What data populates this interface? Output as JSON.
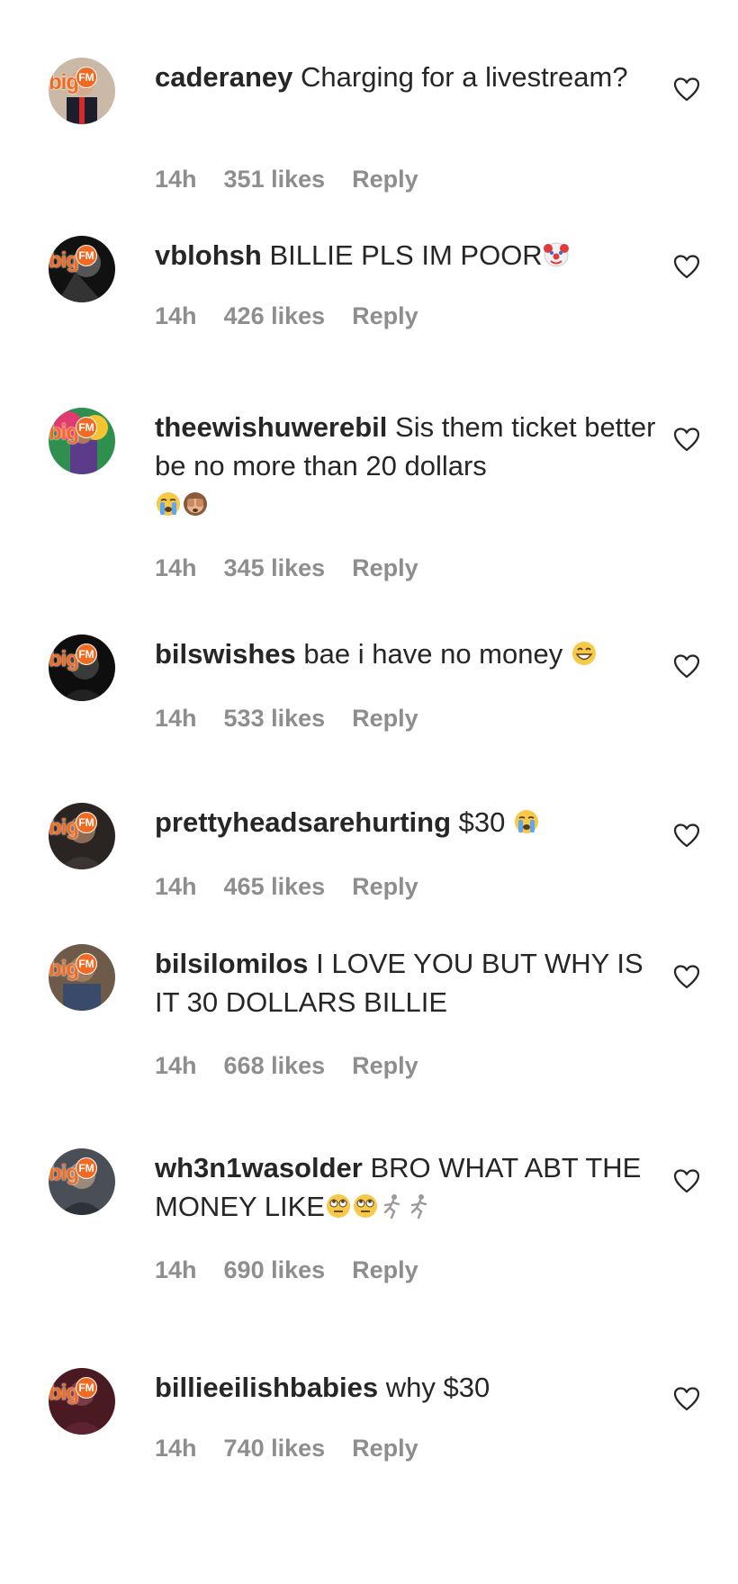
{
  "comments": [
    {
      "user": "caderaney",
      "text": "Charging for a livestream?",
      "emoji": "",
      "time": "14h",
      "likes": "351 likes",
      "reply": "Reply"
    },
    {
      "user": "vblohsh",
      "text": "BILLIE PLS IM POOR",
      "emoji": "clown-face",
      "time": "14h",
      "likes": "426 likes",
      "reply": "Reply"
    },
    {
      "user": "theewishuwerebil",
      "text": "Sis them ticket better be no more than 20 dollars",
      "emoji": "crying-face see-no-evil-monkey",
      "time": "14h",
      "likes": "345 likes",
      "reply": "Reply"
    },
    {
      "user": "bilswishes",
      "text": "bae i have no money",
      "emoji": "grinning-face",
      "time": "14h",
      "likes": "533 likes",
      "reply": "Reply"
    },
    {
      "user": "prettyheadsarehurting",
      "text": "$30",
      "emoji": "crying-face",
      "time": "14h",
      "likes": "465 likes",
      "reply": "Reply"
    },
    {
      "user": "bilsilomilos",
      "text": "I LOVE YOU BUT WHY IS IT 30 DOLLARS BILLIE",
      "emoji": "",
      "time": "14h",
      "likes": "668 likes",
      "reply": "Reply"
    },
    {
      "user": "wh3n1wasolder",
      "text": "BRO WHAT ABT THE MONEY LIKE",
      "emoji": "eye-roll eye-roll running running",
      "time": "14h",
      "likes": "690 likes",
      "reply": "Reply"
    },
    {
      "user": "billieeilishbabies",
      "text": "why $30",
      "emoji": "",
      "time": "14h",
      "likes": "740 likes",
      "reply": "Reply"
    }
  ],
  "avatar_logo": {
    "big": "big",
    "fm": "FM"
  },
  "colors": {
    "text": "#262626",
    "meta": "#8e8e8e",
    "logo": "#f26a21"
  }
}
